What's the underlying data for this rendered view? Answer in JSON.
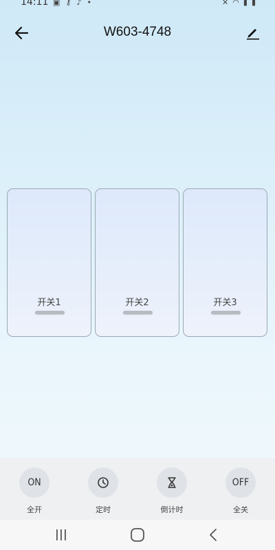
{
  "status": {
    "time": "14:11"
  },
  "header": {
    "title": "W603-4748"
  },
  "switches": [
    {
      "label": "开关1"
    },
    {
      "label": "开关2"
    },
    {
      "label": "开关3"
    }
  ],
  "actions": [
    {
      "icon_text": "ON",
      "label": "全开",
      "icon": "on-icon"
    },
    {
      "icon_text": "",
      "label": "定时",
      "icon": "clock-icon"
    },
    {
      "icon_text": "",
      "label": "倒计时",
      "icon": "hourglass-icon"
    },
    {
      "icon_text": "OFF",
      "label": "全关",
      "icon": "off-icon"
    }
  ],
  "nav": [
    "recent-apps-icon",
    "home-icon",
    "back-icon"
  ]
}
